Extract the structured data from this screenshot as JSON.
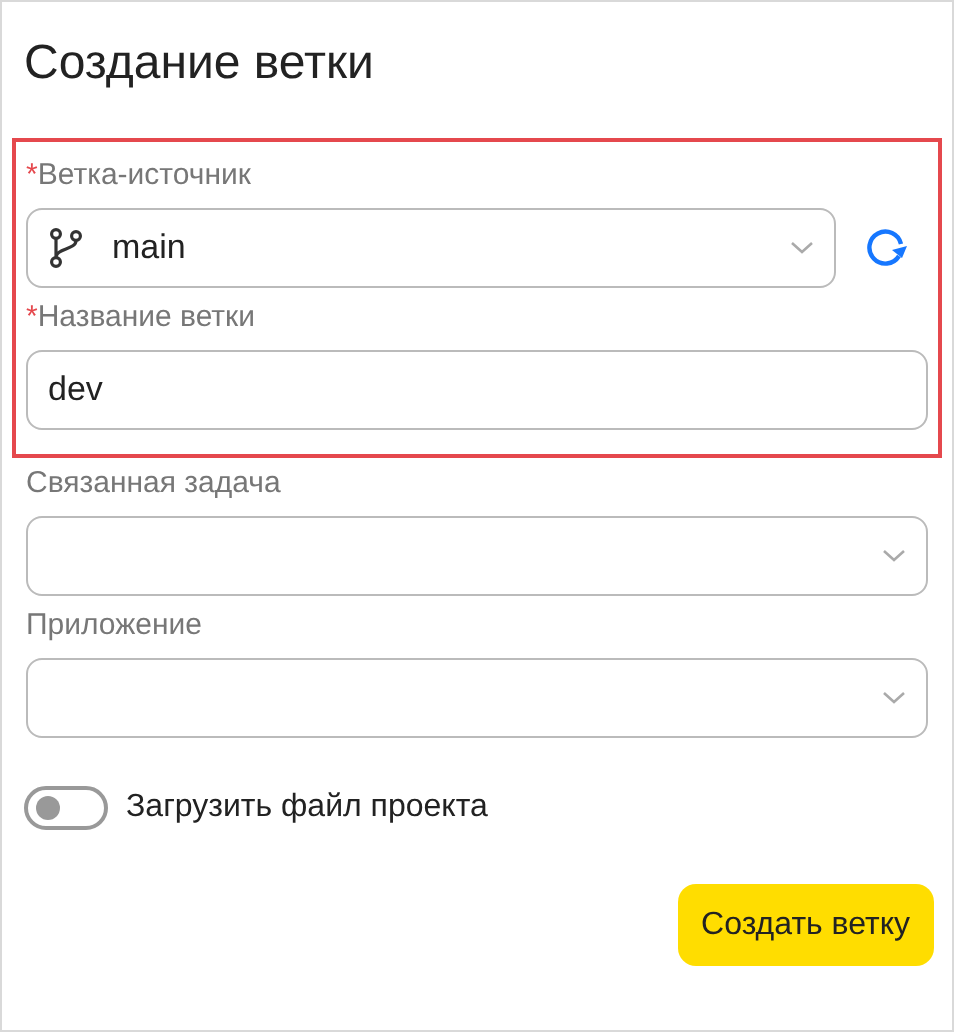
{
  "title": "Создание ветки",
  "highlight_box": {
    "fields": [
      {
        "kind": "select",
        "label": "Ветка-источник",
        "required_mark": "*",
        "value": "main",
        "branch_icon": true,
        "refresh": true
      },
      {
        "kind": "input",
        "label": "Название ветки",
        "required_mark": "*",
        "value": "dev"
      }
    ]
  },
  "fields": [
    {
      "kind": "select",
      "label": "Связанная задача"
    },
    {
      "kind": "select",
      "label": "Приложение"
    }
  ],
  "toggle": {
    "label": "Загрузить файл проекта",
    "on": false
  },
  "button": "Создать ветку"
}
